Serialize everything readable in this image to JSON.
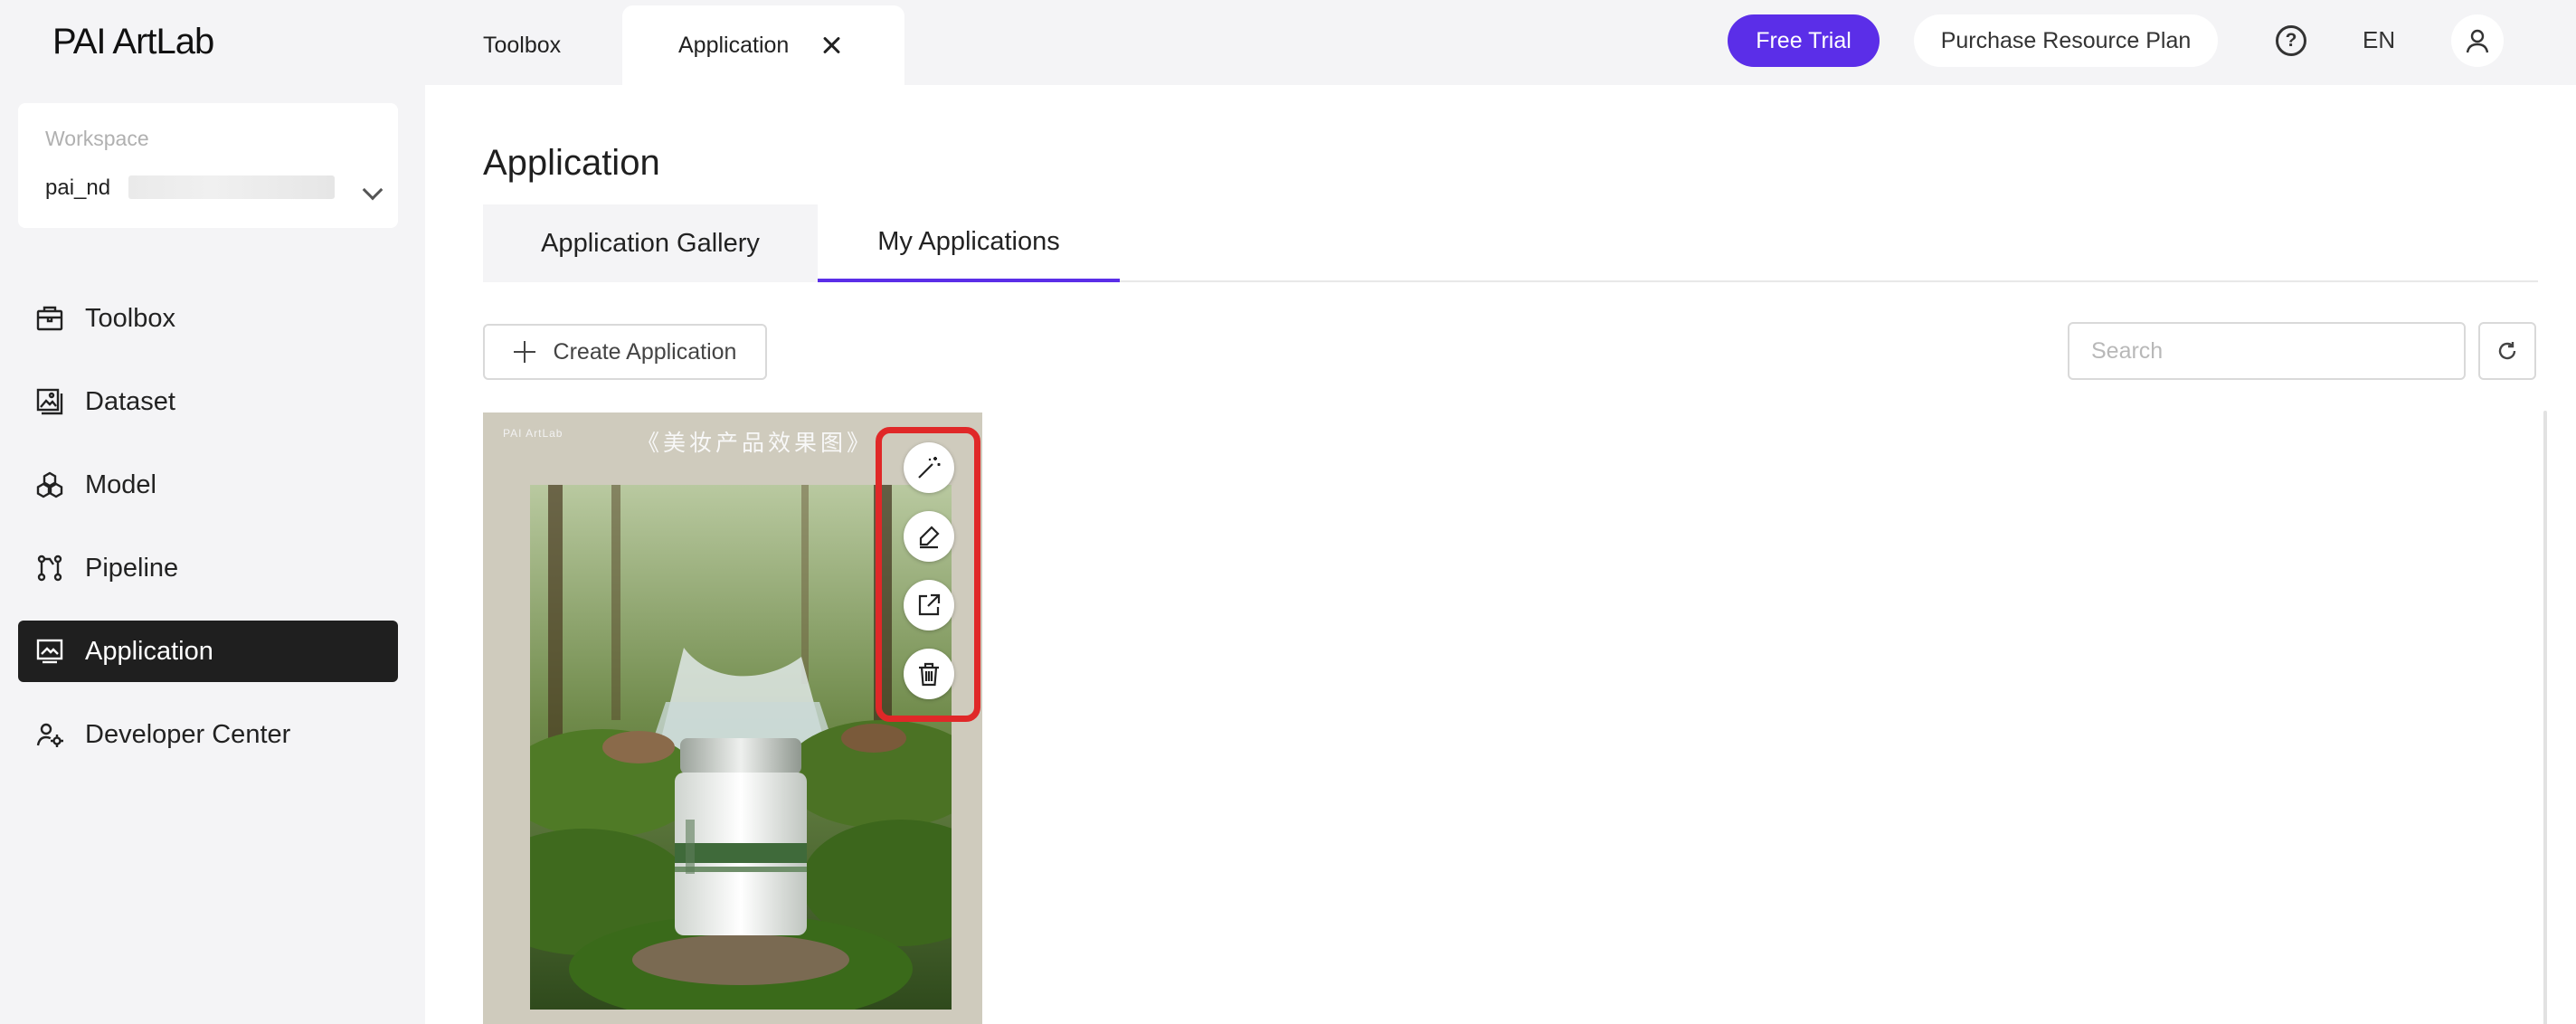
{
  "header": {
    "logo": "PAI ArtLab",
    "tabs": [
      {
        "label": "Toolbox"
      },
      {
        "label": "Application"
      }
    ],
    "free_trial_label": "Free Trial",
    "purchase_label": "Purchase Resource Plan",
    "language": "EN",
    "accent_color": "#5b2ee8"
  },
  "sidebar": {
    "workspace_label": "Workspace",
    "workspace_value": "pai_nd",
    "items": [
      {
        "label": "Toolbox",
        "icon": "toolbox-icon"
      },
      {
        "label": "Dataset",
        "icon": "dataset-icon"
      },
      {
        "label": "Model",
        "icon": "model-icon"
      },
      {
        "label": "Pipeline",
        "icon": "pipeline-icon"
      },
      {
        "label": "Application",
        "icon": "application-icon",
        "active": true
      },
      {
        "label": "Developer Center",
        "icon": "developer-center-icon"
      }
    ]
  },
  "main": {
    "title": "Application",
    "tabs": [
      {
        "label": "Application Gallery"
      },
      {
        "label": "My Applications",
        "active": true
      }
    ],
    "create_label": "Create Application",
    "search_placeholder": "Search",
    "card": {
      "brand": "PAI ArtLab",
      "caption": "《美妆产品效果图》",
      "actions": [
        "magic-wand-icon",
        "edit-icon",
        "open-external-icon",
        "trash-icon"
      ]
    }
  }
}
